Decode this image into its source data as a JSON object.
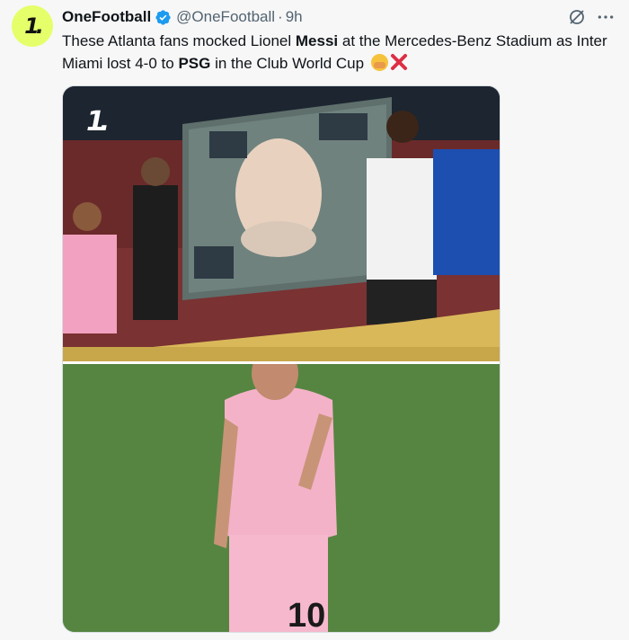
{
  "tweet": {
    "display_name": "OneFootball",
    "handle": "@OneFootball",
    "separator": "·",
    "time": "9h",
    "text_parts": {
      "p1": "These Atlanta fans mocked Lionel ",
      "b1": "Messi",
      "p2": " at the Mercedes-Benz Stadium as Inter Miami lost 4-0 to ",
      "b2": "PSG",
      "p3": " in the Club World Cup "
    }
  },
  "icons": {
    "avatar": "onefootball-logo",
    "verified": "verified-badge-icon",
    "grok": "grok-icon",
    "more": "more-dots-icon"
  },
  "colors": {
    "verified": "#1d9bf0",
    "avatar_bg": "#e5ff6b",
    "secondary_text": "#536471"
  }
}
